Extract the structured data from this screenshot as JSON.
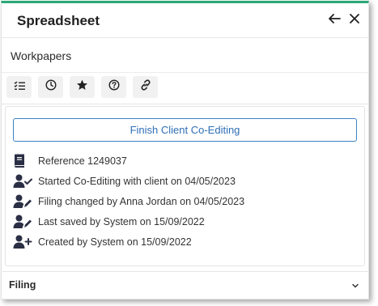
{
  "header": {
    "title": "Spreadsheet",
    "back_icon": "arrow-left-icon",
    "close_icon": "close-icon"
  },
  "subheader": {
    "title": "Workpapers"
  },
  "toolbar": {
    "buttons": [
      {
        "icon": "checklist-icon"
      },
      {
        "icon": "clock-icon"
      },
      {
        "icon": "star-icon"
      },
      {
        "icon": "help-circle-icon"
      },
      {
        "icon": "link-icon"
      }
    ]
  },
  "content": {
    "finish_button_label": "Finish Client Co-Editing",
    "rows": [
      {
        "icon": "book-icon",
        "text": "Reference 1249037"
      },
      {
        "icon": "user-check-icon",
        "text": "Started Co-Editing with client on 04/05/2023"
      },
      {
        "icon": "user-edit-icon",
        "text": "Filing changed by Anna Jordan on 04/05/2023"
      },
      {
        "icon": "user-edit-icon",
        "text": "Last saved by System on 15/09/2022"
      },
      {
        "icon": "user-plus-icon",
        "text": "Created by System on 15/09/2022"
      }
    ]
  },
  "filing": {
    "label": "Filing",
    "chevron_icon": "chevron-down-icon"
  },
  "colors": {
    "accent": "#2aa876",
    "button_blue": "#3b82c4",
    "icon_dark": "#2b2f45"
  }
}
